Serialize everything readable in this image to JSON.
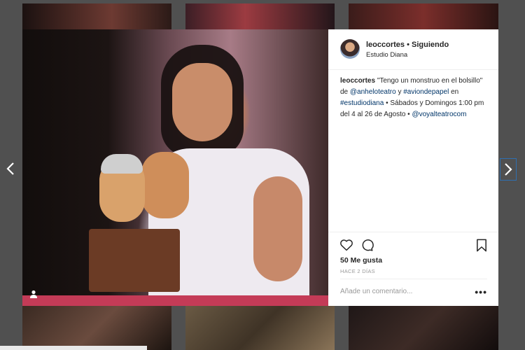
{
  "post": {
    "username": "leoccortes",
    "separator": "•",
    "follow_status": "Siguiendo",
    "location": "Estudio Diana",
    "caption": {
      "author": "leoccortes",
      "text1": "\"Tengo un monstruo en el bolsillo\" de",
      "mention1": "@anheloteatro",
      "text2": "y",
      "hashtag1": "#aviondepapel",
      "text3": "en",
      "hashtag2": "#estudiodiana",
      "text4": "• Sábados y Domingos 1:00 pm del 4 al 26 de Agosto •",
      "mention2": "@voyalteatrocom"
    },
    "likes": "50 Me gusta",
    "timestamp": "HACE 2 DÍAS",
    "comment_placeholder": "Añade un comentario...",
    "more_label": "•••"
  },
  "icons": {
    "user_tag": "user-tag-icon",
    "heart": "heart-icon",
    "comment": "comment-icon",
    "save": "bookmark-icon",
    "prev": "chevron-left-icon",
    "next": "chevron-right-icon"
  },
  "colors": {
    "link": "#003569",
    "text": "#262626",
    "muted": "#999999",
    "next_border": "#2f6fb0"
  }
}
